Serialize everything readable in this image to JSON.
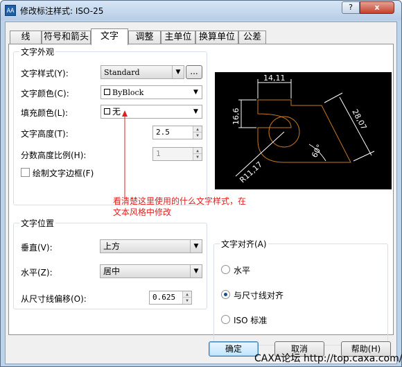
{
  "window": {
    "app_icon": "AA",
    "title": "修改标注样式: ISO-25",
    "help_button": "?",
    "close_button": "x"
  },
  "tabs": [
    {
      "label": "线"
    },
    {
      "label": "符号和箭头"
    },
    {
      "label": "文字"
    },
    {
      "label": "调整"
    },
    {
      "label": "主单位"
    },
    {
      "label": "换算单位"
    },
    {
      "label": "公差"
    }
  ],
  "appearance": {
    "legend": "文字外观",
    "text_style": {
      "label": "文字样式(Y):",
      "value": "Standard",
      "browse_button": "..."
    },
    "text_color": {
      "label": "文字颜色(C):",
      "value": "ByBlock"
    },
    "fill_color": {
      "label": "填充颜色(L):",
      "value": "无"
    },
    "text_height": {
      "label": "文字高度(T):",
      "value": "2.5"
    },
    "fraction_scale": {
      "label": "分数高度比例(H):",
      "value": "1"
    },
    "draw_frame": {
      "label": "绘制文字边框(F)",
      "checked": false
    }
  },
  "annotation": {
    "line1": "看清楚这里使用的什么文字样式，在",
    "line2": "文本风格中修改",
    "color": "#e02020"
  },
  "placement": {
    "legend": "文字位置",
    "vertical": {
      "label": "垂直(V):",
      "value": "上方"
    },
    "horizontal": {
      "label": "水平(Z):",
      "value": "居中"
    },
    "offset": {
      "label": "从尺寸线偏移(O):",
      "value": "0.625"
    }
  },
  "alignment": {
    "legend": "文字对齐(A)",
    "options": [
      {
        "label": "水平",
        "checked": false
      },
      {
        "label": "与尺寸线对齐",
        "checked": true
      },
      {
        "label": "ISO 标准",
        "checked": false
      }
    ]
  },
  "preview": {
    "dim_top": "14,11",
    "dim_left": "16,6",
    "dim_right": "28,07",
    "dim_angle": "60°",
    "dim_radius": "R11,17",
    "geometry_color": "#c8781e",
    "dimension_color": "#ffffff"
  },
  "buttons": {
    "ok": "确定",
    "cancel": "取消",
    "help": "帮助(H)"
  },
  "watermark": "CAXA论坛  http://top.caxa.com/"
}
